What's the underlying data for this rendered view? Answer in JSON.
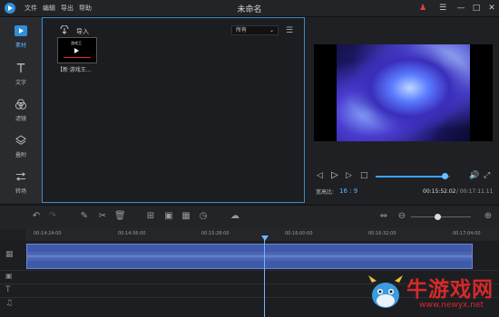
{
  "app": {
    "title": "未命名",
    "menu": [
      "文件",
      "编辑",
      "导出",
      "帮助"
    ]
  },
  "window_controls": [
    "user-icon",
    "menu-icon",
    "minimize-icon",
    "maximize-icon",
    "close-icon"
  ],
  "sidebar": {
    "items": [
      {
        "label": "素材",
        "icon": "media-play-icon",
        "active": true
      },
      {
        "label": "文字",
        "icon": "text-icon",
        "active": false
      },
      {
        "label": "滤镜",
        "icon": "filter-circles-icon",
        "active": false
      },
      {
        "label": "叠附",
        "icon": "overlay-layers-icon",
        "active": false
      },
      {
        "label": "转场",
        "icon": "transition-arrows-icon",
        "active": false
      }
    ]
  },
  "media_panel": {
    "import_label": "导入",
    "filter_dropdown": "所有",
    "items": [
      {
        "name": "【新·游戏王...",
        "thumb_text": "游戏王"
      }
    ]
  },
  "preview": {
    "aspect_label": "宽高比:",
    "aspect_value": "16 : 9",
    "current_time": "00:15:52.02",
    "total_time": "/ 00:17:11.11",
    "progress": 0.93
  },
  "timeline": {
    "ruler_labels": [
      "00:14:24:00",
      "00:14:56:00",
      "00:15:28:00",
      "00:16:00:00",
      "00:16:32:00",
      "00:17:04:00"
    ],
    "zoom_level": 0.45
  },
  "watermark": {
    "brand": "牛游戏网",
    "url": "www.newyx.net"
  },
  "colors": {
    "accent": "#3aa3ff",
    "clip": "#3f5aa8",
    "watermark": "#d6292b"
  }
}
